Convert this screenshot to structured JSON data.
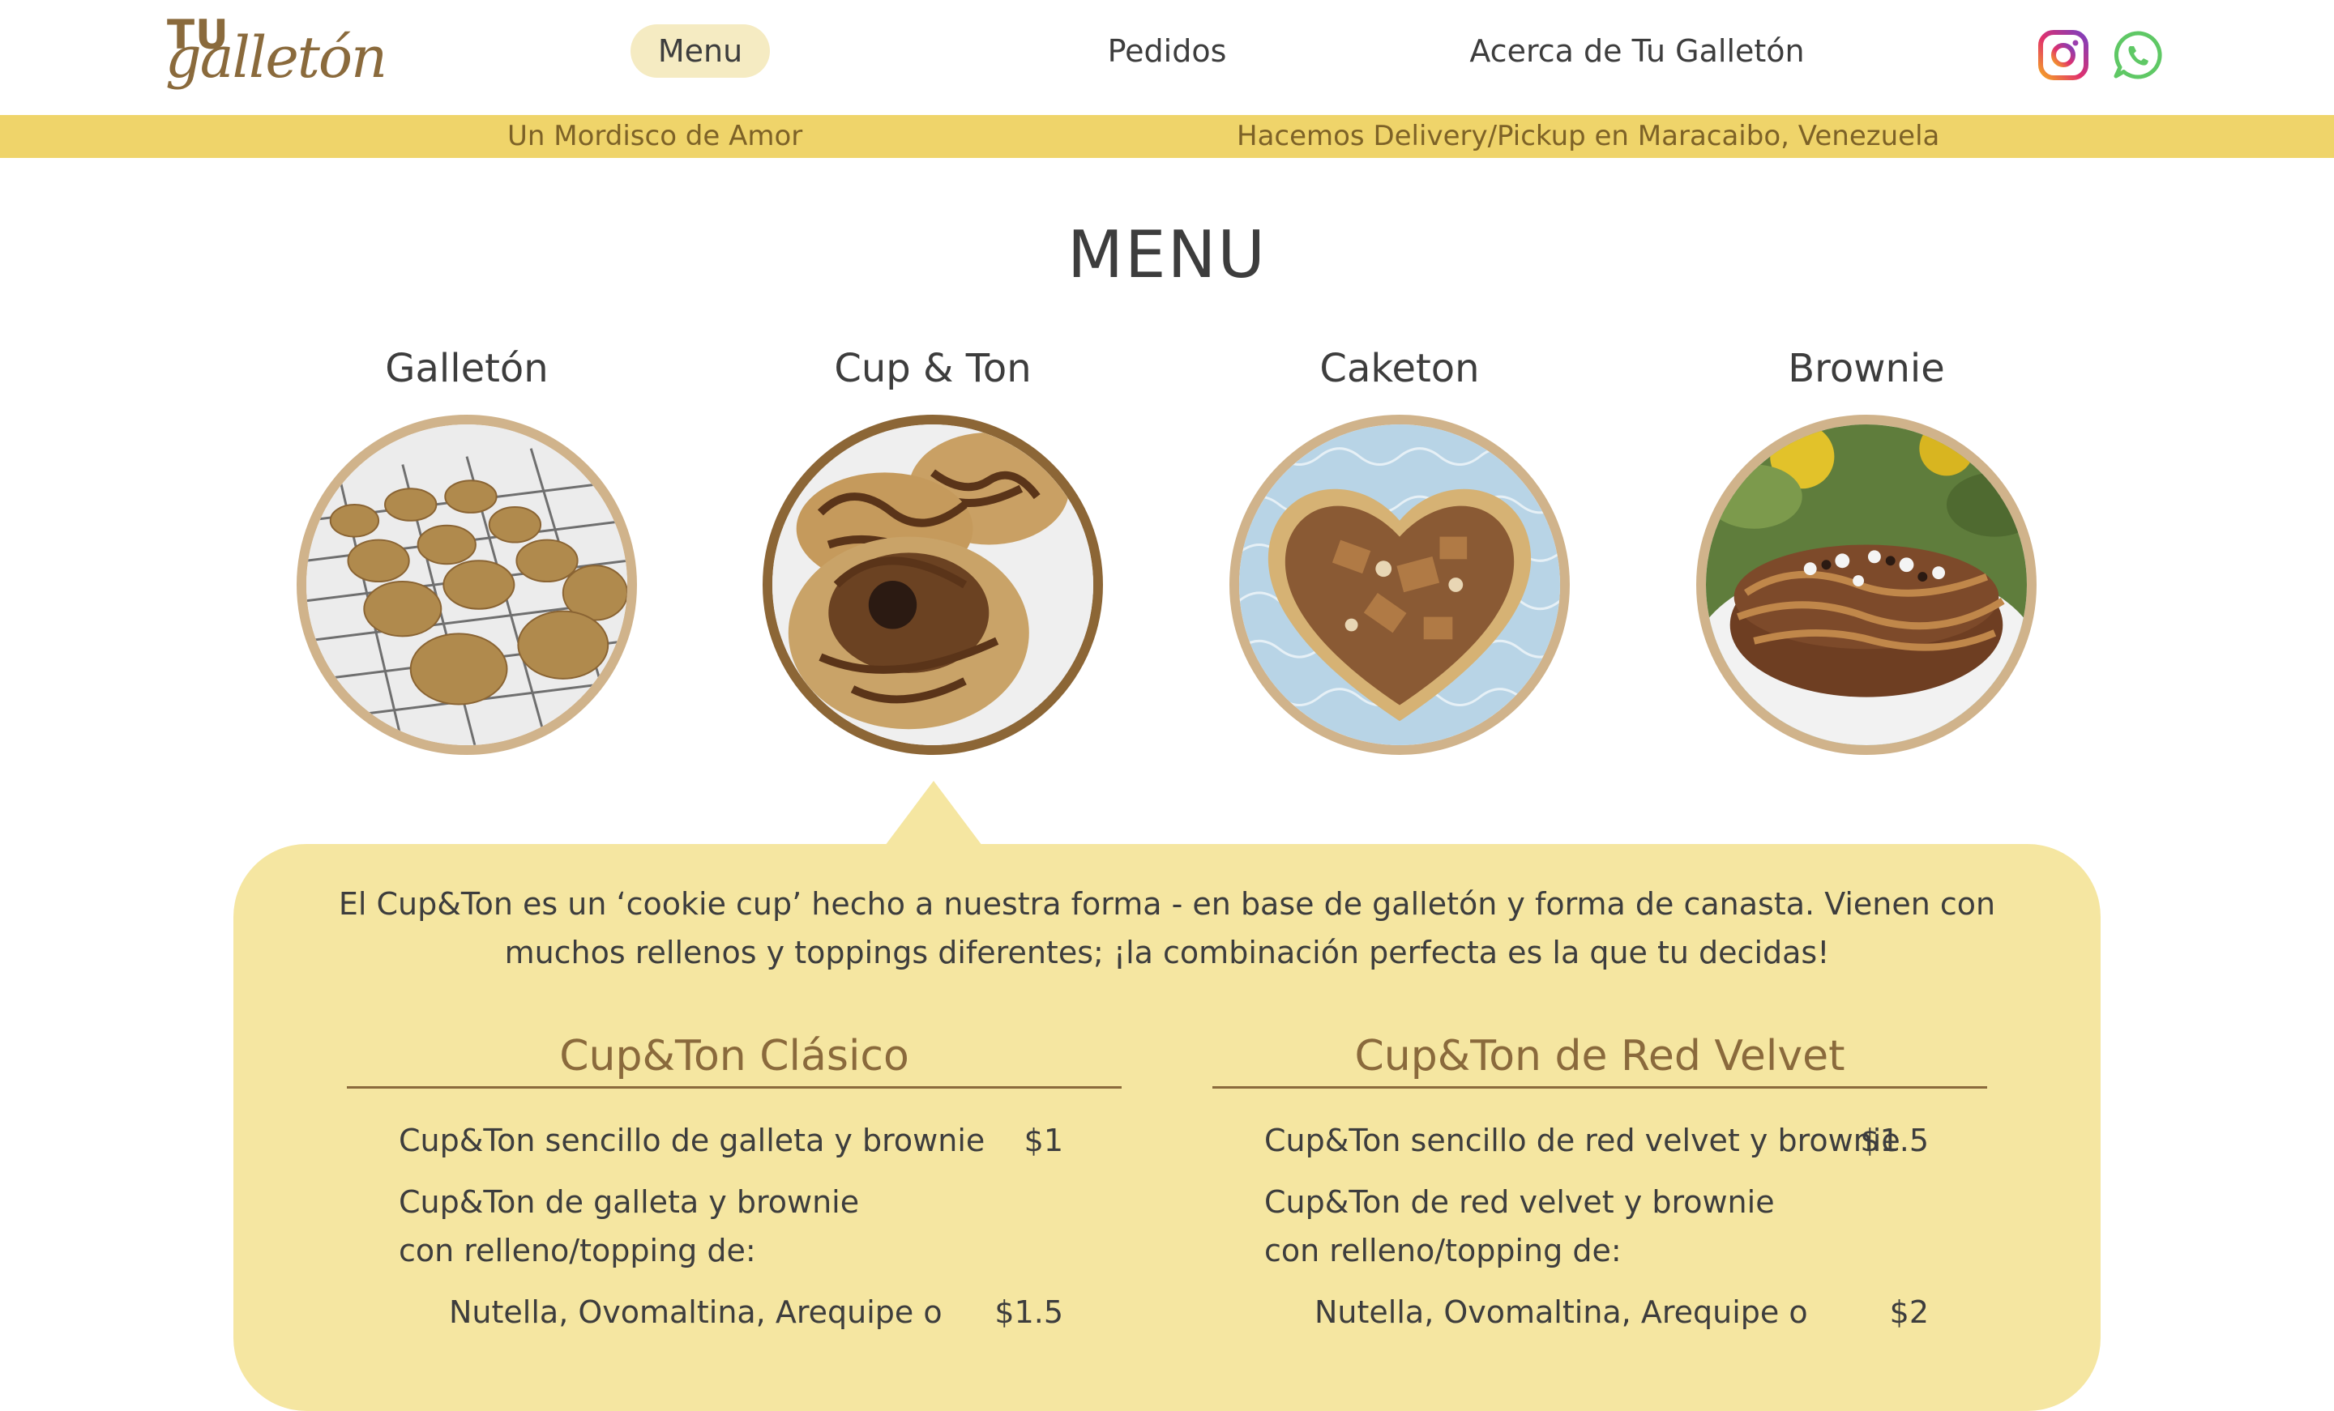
{
  "header": {
    "logo_text": "TU galletón",
    "logo_top": "TU",
    "logo_script": "galletón",
    "nav": [
      {
        "label": "Menu",
        "active": true
      },
      {
        "label": "Pedidos",
        "active": false
      },
      {
        "label": "Acerca de Tu Galletón",
        "active": false
      }
    ],
    "social": [
      {
        "icon": "instagram-icon"
      },
      {
        "icon": "whatsapp-icon"
      }
    ]
  },
  "banner": {
    "left": "Un Mordisco de Amor",
    "right": "Hacemos Delivery/Pickup en Maracaibo, Venezuela"
  },
  "page_title": "MENU",
  "categories": [
    {
      "label": "Galletón",
      "active": false
    },
    {
      "label": "Cup & Ton",
      "active": true
    },
    {
      "label": "Caketon",
      "active": false
    },
    {
      "label": "Brownie",
      "active": false
    }
  ],
  "detail": {
    "description": "El Cup&Ton es un ‘cookie cup’ hecho a nuestra forma - en base de galletón y forma de canasta. Vienen con muchos rellenos y toppings diferentes; ¡la combinación perfecta es la que tu decidas!",
    "columns": [
      {
        "title": "Cup&Ton Clásico",
        "items": [
          {
            "label": "Cup&Ton sencillo de galleta y brownie",
            "price": "$1"
          },
          {
            "label": "Cup&Ton de galleta y brownie con relleno/topping de:",
            "price": ""
          },
          {
            "label": "Nutella, Ovomaltina, Arequipe o",
            "price": "$1.5"
          }
        ]
      },
      {
        "title": "Cup&Ton de Red Velvet",
        "items": [
          {
            "label": "Cup&Ton sencillo de red velvet y brownie",
            "price": "$1.5"
          },
          {
            "label": "Cup&Ton de red velvet y brownie con relleno/topping de:",
            "price": ""
          },
          {
            "label": "Nutella, Ovomaltina, Arequipe o",
            "price": "$2"
          }
        ]
      }
    ]
  },
  "colors": {
    "banner": "#efd46a",
    "card": "#f5e6a1",
    "brand_brown": "#8a6a3c",
    "active_nav": "#f5ebc2"
  }
}
